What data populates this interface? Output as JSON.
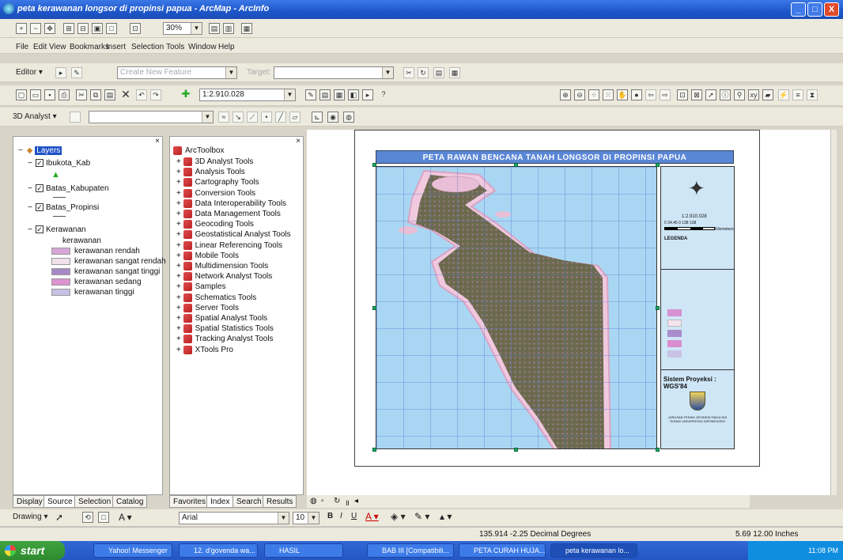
{
  "window": {
    "title": "peta kerawanan longsor di propinsi papua - ArcMap - ArcInfo",
    "buttons": [
      "_",
      "□",
      "X"
    ]
  },
  "standard_toolbar_top": {
    "zoom_value": "30%"
  },
  "menubar": [
    "File",
    "Edit",
    "View",
    "Bookmarks",
    "Insert",
    "Selection",
    "Tools",
    "Window",
    "Help"
  ],
  "editor_toolbar": {
    "label": "Editor ▾",
    "task_combo": "Create New Feature",
    "target_label": "Target:"
  },
  "standard_toolbar": {
    "scale_value": "1:2.910.028"
  },
  "analyst_toolbar": {
    "label": "3D Analyst ▾"
  },
  "toc": {
    "root": "Layers",
    "layers": [
      {
        "name": "Ibukota_Kab",
        "checked": true
      },
      {
        "name": "Batas_Kabupaten",
        "checked": true
      },
      {
        "name": "Batas_Propinsi",
        "checked": true
      },
      {
        "name": "Kerawanan",
        "checked": true
      }
    ],
    "kerawanan_field": "kerawanan",
    "legend": [
      {
        "label": "kerawanan rendah",
        "color": "#d7a6d8"
      },
      {
        "label": "kerawanan sangat rendah",
        "color": "#efe0ea"
      },
      {
        "label": "kerawanan sangat tinggi",
        "color": "#a789c6"
      },
      {
        "label": "kerawanan sedang",
        "color": "#dc93d0"
      },
      {
        "label": "kerawanan tinggi",
        "color": "#c7c1e4"
      }
    ],
    "tabs": [
      "Display",
      "Source",
      "Selection",
      "Catalog"
    ]
  },
  "toolbox": {
    "root": "ArcToolbox",
    "items": [
      "3D Analyst Tools",
      "Analysis Tools",
      "Cartography Tools",
      "Conversion Tools",
      "Data Interoperability Tools",
      "Data Management Tools",
      "Geocoding Tools",
      "Geostatistical Analyst Tools",
      "Linear Referencing Tools",
      "Mobile Tools",
      "Multidimension Tools",
      "Network Analyst Tools",
      "Samples",
      "Schematics Tools",
      "Server Tools",
      "Spatial Analyst Tools",
      "Spatial Statistics Tools",
      "Tracking Analyst Tools",
      "XTools Pro"
    ],
    "tabs": [
      "Favorites",
      "Index",
      "Search",
      "Results"
    ]
  },
  "layout": {
    "map_title": "PETA RAWAN BENCANA TANAH LONGSOR DI PROPINSI PAPUA",
    "scale_text": "1:2.910.028",
    "scalebar_ticks": [
      "0",
      "34.45",
      "0",
      "138",
      "138"
    ],
    "scalebar_unit": "Kilometers",
    "legend_heading": "LEGENDA",
    "projection_text": "Sistem Proyeksi : WGS'84",
    "credit_text": "JURUSAN TEKNIK GEODESI FAKULTAS TEKNIK UNIVERSITAS DIPONEGORO",
    "legend_colors": [
      "#d792d2",
      "#f5e3ee",
      "#a98dcb",
      "#d98ecf",
      "#c9c3e5"
    ]
  },
  "drawing_toolbar": {
    "label": "Drawing ▾",
    "font": "Arial",
    "size": "10"
  },
  "status": {
    "coords": "135.914  -2.25 Decimal Degrees",
    "page_coords": "5.69  12.00 Inches"
  },
  "taskbar": {
    "start": "start",
    "tasks": [
      "Yahoo! Messenger",
      "12. d'govenda wa...",
      "HASIL",
      "BAB III [Compatibili...",
      "PETA CURAH HUJA...",
      "peta kerawanan lo..."
    ],
    "clock": "11:08 PM"
  }
}
